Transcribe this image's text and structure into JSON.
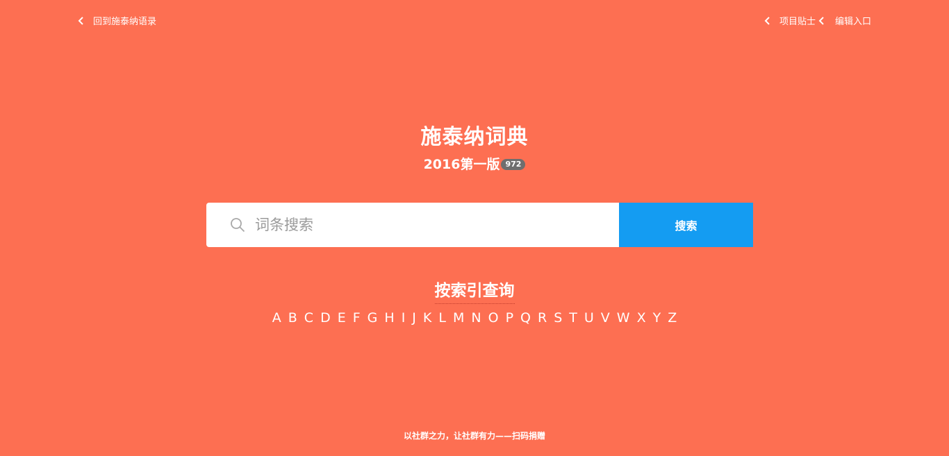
{
  "nav": {
    "back_label": "回到施泰纳语录",
    "tips_label": "项目贴士",
    "edit_label": "编辑入口"
  },
  "header": {
    "title": "施泰纳词典",
    "subtitle": "2016第一版",
    "count_badge": "972"
  },
  "search": {
    "placeholder": "词条搜索",
    "value": "",
    "button_label": "搜索"
  },
  "index": {
    "title": "按索引查询",
    "letters": [
      "A",
      "B",
      "C",
      "D",
      "E",
      "F",
      "G",
      "H",
      "I",
      "J",
      "K",
      "L",
      "M",
      "N",
      "O",
      "P",
      "Q",
      "R",
      "S",
      "T",
      "U",
      "V",
      "W",
      "X",
      "Y",
      "Z"
    ]
  },
  "footer": {
    "text": "以社群之力，让社群有力——扫码捐赠"
  },
  "colors": {
    "background": "#fd6f52",
    "search_button": "#149cf2",
    "badge": "#6e6e6e"
  }
}
